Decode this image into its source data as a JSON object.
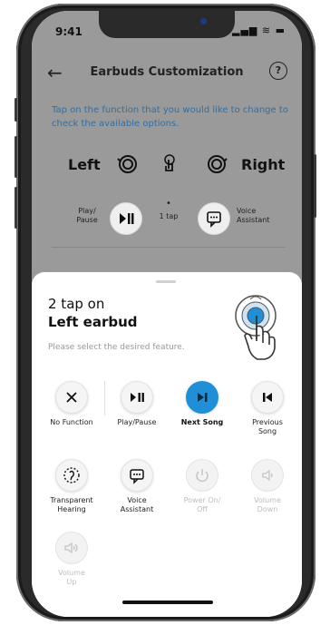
{
  "status": {
    "time": "9:41",
    "icons": "▂▄▆ ≋ ▬"
  },
  "header": {
    "title": "Earbuds Customization",
    "help": "?",
    "back": "←"
  },
  "instruction": "Tap on the function that you would like to change to check the available options.",
  "sides": {
    "left": "Left",
    "right": "Right"
  },
  "current": {
    "left_label": "Play/\nPause",
    "tap_label": "1 tap",
    "right_label": "Voice\nAssistant"
  },
  "sheet": {
    "title_line1": "2 tap on",
    "title_line2": "Left earbud",
    "subtitle": "Please select the desired feature."
  },
  "options": [
    {
      "label": "No Function",
      "icon": "close-icon",
      "state": "normal"
    },
    {
      "label": "Play/Pause",
      "icon": "play-pause-icon",
      "state": "normal"
    },
    {
      "label": "Next Song",
      "icon": "next-song-icon",
      "state": "selected"
    },
    {
      "label": "Previous Song",
      "icon": "previous-song-icon",
      "state": "normal"
    },
    {
      "label": "Transparent Hearing",
      "icon": "transparent-hearing-icon",
      "state": "normal"
    },
    {
      "label": "Voice Assistant",
      "icon": "voice-assistant-icon",
      "state": "normal"
    },
    {
      "label": "Power On/ Off",
      "icon": "power-icon",
      "state": "disabled"
    },
    {
      "label": "Volume Down",
      "icon": "volume-down-icon",
      "state": "disabled"
    },
    {
      "label": "Volume Up",
      "icon": "volume-up-icon",
      "state": "disabled"
    }
  ],
  "colors": {
    "accent": "#1f8fd8",
    "instruction": "#2f6fa5",
    "overlay": "#9a9a9a"
  }
}
